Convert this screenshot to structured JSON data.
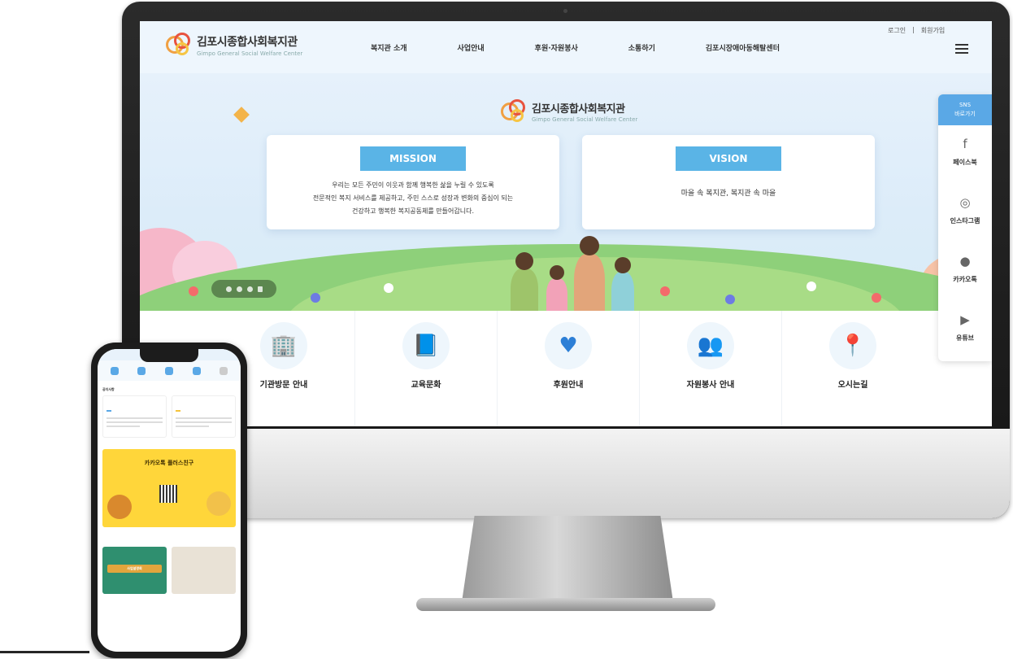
{
  "site": {
    "name": "김포시종합사회복지관",
    "name_en": "Gimpo General Social Welfare Center"
  },
  "header": {
    "nav": [
      "복지관 소개",
      "사업안내",
      "후원·자원봉사",
      "소통하기",
      "김포시장애아동해탈센터"
    ],
    "util": [
      "로그인",
      "|",
      "회원가입"
    ]
  },
  "hero": {
    "mission": {
      "label": "MISSION",
      "lines": [
        "우리는 모든 주민이 이웃과 함께 행복한 삶을 누릴 수 있도록",
        "전문적인 복지 서비스를 제공하고, 주민 스스로 성장과 변화의 중심이 되는",
        "건강하고 행복한 복지공동체를 만들어갑니다."
      ]
    },
    "vision": {
      "label": "VISION",
      "text": "마을 속 복지관, 복지관 속 마을"
    }
  },
  "quick_menu": [
    {
      "label": "기관방문 안내",
      "icon": "building-icon"
    },
    {
      "label": "교육문화",
      "icon": "book-icon"
    },
    {
      "label": "후원안내",
      "icon": "heart-icon"
    },
    {
      "label": "자원봉사 안내",
      "icon": "people-icon"
    },
    {
      "label": "오시는길",
      "icon": "map-pin-icon"
    }
  ],
  "sns": {
    "title_line1": "SNS",
    "title_line2": "바로가기",
    "items": [
      {
        "label": "페이스북",
        "icon": "facebook-icon"
      },
      {
        "label": "인스타그램",
        "icon": "instagram-icon"
      },
      {
        "label": "카카오톡",
        "icon": "kakaotalk-icon"
      },
      {
        "label": "유튜브",
        "icon": "youtube-icon"
      }
    ]
  },
  "mobile": {
    "section_title": "공지사항",
    "kakao_title": "카카오톡 플러스친구",
    "banner_text": "사업설명회"
  },
  "colors": {
    "accent": "#5ab4e6",
    "kakao_yellow": "#ffd63a"
  }
}
